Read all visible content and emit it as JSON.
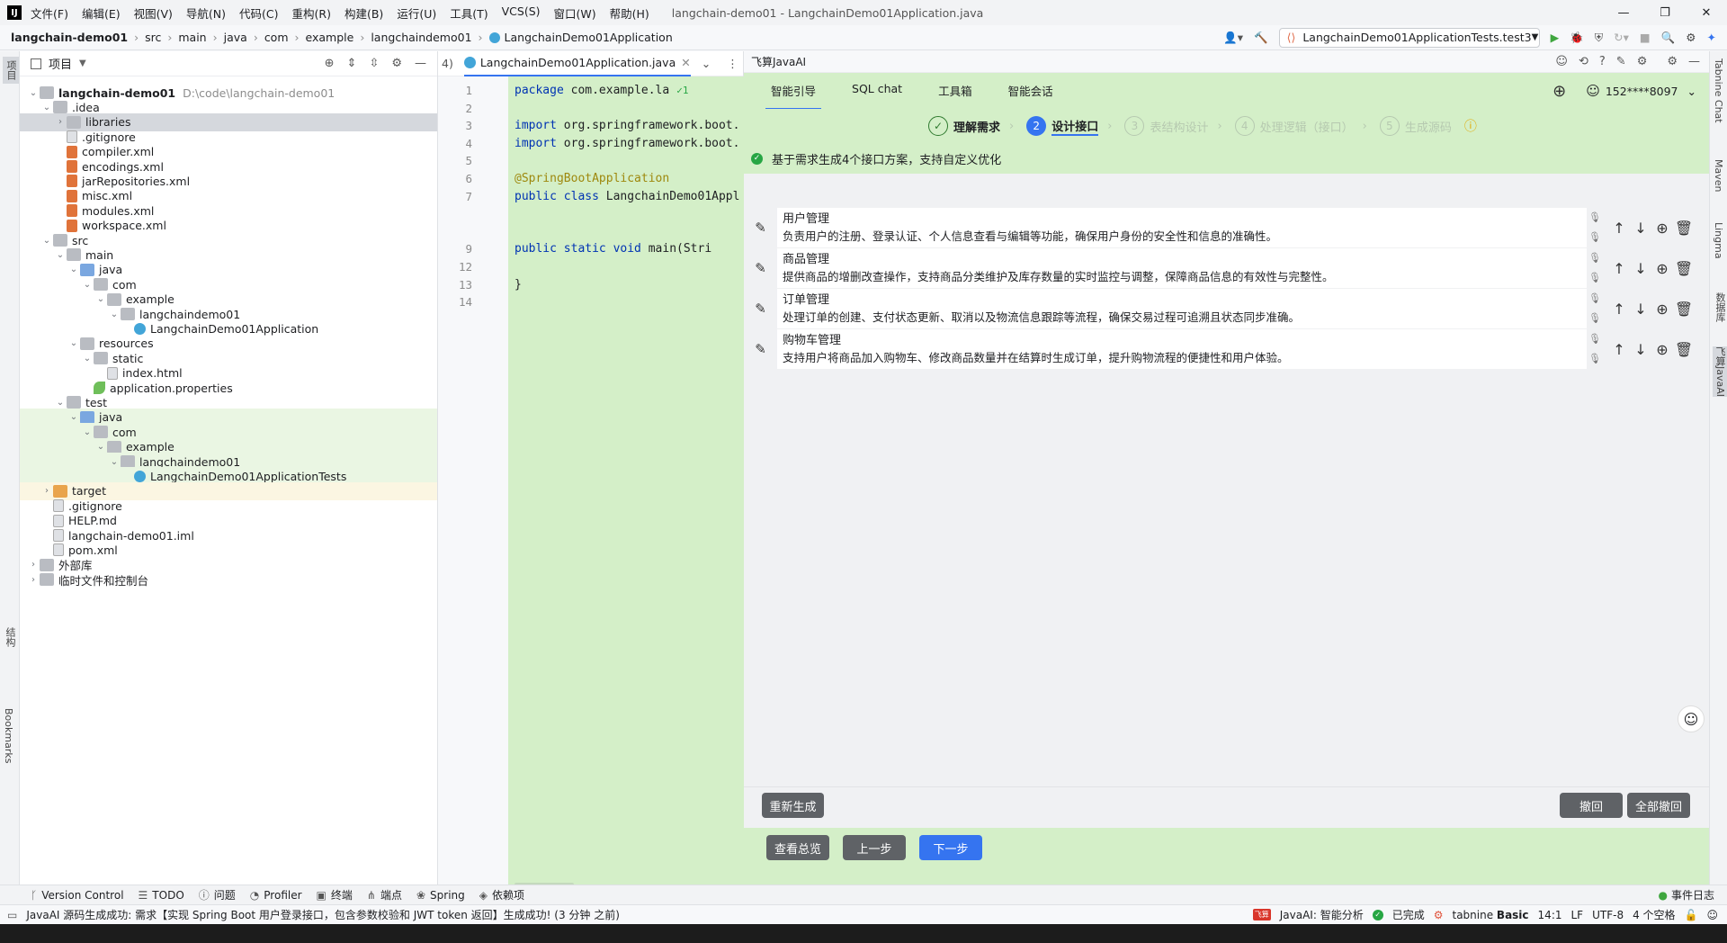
{
  "app": {
    "menus": [
      "文件(F)",
      "编辑(E)",
      "视图(V)",
      "导航(N)",
      "代码(C)",
      "重构(R)",
      "构建(B)",
      "运行(U)",
      "工具(T)",
      "VCS(S)",
      "窗口(W)",
      "帮助(H)"
    ],
    "window_title": "langchain-demo01 - LangchainDemo01Application.java"
  },
  "breadcrumbs": [
    "langchain-demo01",
    "src",
    "main",
    "java",
    "com",
    "example",
    "langchaindemo01",
    "LangchainDemo01Application"
  ],
  "run_config": "LangchainDemo01ApplicationTests.test3",
  "left_strip": {
    "project": "项目",
    "structure": "结构",
    "bookmarks": "Bookmarks"
  },
  "project_panel": {
    "title": "项目",
    "tree": [
      {
        "label": "langchain-demo01",
        "hint": "D:\\code\\langchain-demo01",
        "depth": 0,
        "arrow": "⌄",
        "icon": "folder",
        "bold": true
      },
      {
        "label": ".idea",
        "depth": 1,
        "arrow": "⌄",
        "icon": "folder"
      },
      {
        "label": "libraries",
        "depth": 2,
        "arrow": "›",
        "icon": "folder",
        "selected": true
      },
      {
        "label": ".gitignore",
        "depth": 2,
        "icon": "file"
      },
      {
        "label": "compiler.xml",
        "depth": 2,
        "icon": "xml"
      },
      {
        "label": "encodings.xml",
        "depth": 2,
        "icon": "xml"
      },
      {
        "label": "jarRepositories.xml",
        "depth": 2,
        "icon": "xml"
      },
      {
        "label": "misc.xml",
        "depth": 2,
        "icon": "xml"
      },
      {
        "label": "modules.xml",
        "depth": 2,
        "icon": "xml"
      },
      {
        "label": "workspace.xml",
        "depth": 2,
        "icon": "xml"
      },
      {
        "label": "src",
        "depth": 1,
        "arrow": "⌄",
        "icon": "folder"
      },
      {
        "label": "main",
        "depth": 2,
        "arrow": "⌄",
        "icon": "folder"
      },
      {
        "label": "java",
        "depth": 3,
        "arrow": "⌄",
        "icon": "folder-blue"
      },
      {
        "label": "com",
        "depth": 4,
        "arrow": "⌄",
        "icon": "folder"
      },
      {
        "label": "example",
        "depth": 5,
        "arrow": "⌄",
        "icon": "folder"
      },
      {
        "label": "langchaindemo01",
        "depth": 6,
        "arrow": "⌄",
        "icon": "folder"
      },
      {
        "label": "LangchainDemo01Application",
        "depth": 7,
        "icon": "jclass"
      },
      {
        "label": "resources",
        "depth": 3,
        "arrow": "⌄",
        "icon": "folder"
      },
      {
        "label": "static",
        "depth": 4,
        "arrow": "⌄",
        "icon": "folder"
      },
      {
        "label": "index.html",
        "depth": 5,
        "icon": "file"
      },
      {
        "label": "application.properties",
        "depth": 4,
        "icon": "leaf"
      },
      {
        "label": "test",
        "depth": 2,
        "arrow": "⌄",
        "icon": "folder"
      },
      {
        "label": "java",
        "depth": 3,
        "arrow": "⌄",
        "icon": "folder-green",
        "green": true
      },
      {
        "label": "com",
        "depth": 4,
        "arrow": "⌄",
        "icon": "folder",
        "green": true
      },
      {
        "label": "example",
        "depth": 5,
        "arrow": "⌄",
        "icon": "folder",
        "green": true
      },
      {
        "label": "langchaindemo01",
        "depth": 6,
        "arrow": "⌄",
        "icon": "folder",
        "green": true
      },
      {
        "label": "LangchainDemo01ApplicationTests",
        "depth": 7,
        "icon": "jclass",
        "green": true
      },
      {
        "label": "target",
        "depth": 1,
        "arrow": "›",
        "icon": "folder-orange",
        "yellow": true
      },
      {
        "label": ".gitignore",
        "depth": 1,
        "icon": "file"
      },
      {
        "label": "HELP.md",
        "depth": 1,
        "icon": "file"
      },
      {
        "label": "langchain-demo01.iml",
        "depth": 1,
        "icon": "file"
      },
      {
        "label": "pom.xml",
        "depth": 1,
        "icon": "file"
      },
      {
        "label": "外部库",
        "depth": 0,
        "arrow": "›",
        "icon": "folder"
      },
      {
        "label": "临时文件和控制台",
        "depth": 0,
        "arrow": "›",
        "icon": "folder"
      }
    ]
  },
  "editor": {
    "tab_prefix": "4)",
    "tab": "LangchainDemo01Application.java",
    "lines": [
      {
        "n": "1",
        "parts": [
          {
            "t": "package ",
            "c": "kw"
          },
          {
            "t": "com.example.la",
            "c": ""
          }
        ],
        "extra": "✓1"
      },
      {
        "n": "2",
        "parts": []
      },
      {
        "n": "3",
        "parts": [
          {
            "t": "import ",
            "c": "kw"
          },
          {
            "t": "org.springframework.boot.",
            "c": ""
          }
        ]
      },
      {
        "n": "4",
        "parts": [
          {
            "t": "import ",
            "c": "kw"
          },
          {
            "t": "org.springframework.boot.",
            "c": ""
          }
        ]
      },
      {
        "n": "5",
        "parts": []
      },
      {
        "n": "6",
        "parts": [
          {
            "t": "@SpringBootApplication",
            "c": "ann"
          }
        ]
      },
      {
        "n": "7",
        "parts": [
          {
            "t": "public class ",
            "c": "kw"
          },
          {
            "t": "LangchainDemo01Appl",
            "c": ""
          }
        ]
      },
      {
        "n": "",
        "parts": []
      },
      {
        "n": "",
        "parts": []
      },
      {
        "n": "9",
        "parts": [
          {
            "t": "    public static void ",
            "c": "kw"
          },
          {
            "t": "main",
            "c": "fn"
          },
          {
            "t": "(Stri",
            "c": ""
          }
        ]
      },
      {
        "n": "12",
        "parts": []
      },
      {
        "n": "13",
        "parts": [
          {
            "t": "}",
            "c": ""
          }
        ]
      },
      {
        "n": "14",
        "parts": []
      }
    ]
  },
  "ai_panel": {
    "title": "飞算JavaAI",
    "tabs": [
      "智能引导",
      "SQL chat",
      "工具箱",
      "智能会话"
    ],
    "user": "152****8097",
    "steps": [
      {
        "num": "✓",
        "label": "理解需求",
        "state": "done"
      },
      {
        "num": "2",
        "label": "设计接口",
        "state": "active"
      },
      {
        "num": "3",
        "label": "表结构设计",
        "state": "todo"
      },
      {
        "num": "4",
        "label": "处理逻辑（接口）",
        "state": "todo"
      },
      {
        "num": "5",
        "label": "生成源码",
        "state": "todo"
      }
    ],
    "notice": "基于需求生成4个接口方案，支持自定义优化",
    "interfaces": [
      {
        "title": "用户管理",
        "desc": "负责用户的注册、登录认证、个人信息查看与编辑等功能，确保用户身份的安全性和信息的准确性。"
      },
      {
        "title": "商品管理",
        "desc": "提供商品的增删改查操作，支持商品分类维护及库存数量的实时监控与调整，保障商品信息的有效性与完整性。"
      },
      {
        "title": "订单管理",
        "desc": "处理订单的创建、支付状态更新、取消以及物流信息跟踪等流程，确保交易过程可追溯且状态同步准确。"
      },
      {
        "title": "购物车管理",
        "desc": "支持用户将商品加入购物车、修改商品数量并在结算时生成订单，提升购物流程的便捷性和用户体验。"
      }
    ],
    "buttons": {
      "regenerate": "重新生成",
      "undo": "撤回",
      "undo_all": "全部撤回",
      "overview": "查看总览",
      "prev": "上一步",
      "next": "下一步"
    }
  },
  "right_strip": [
    "Tabnine Chat",
    "Maven",
    "Lingma",
    "数据库",
    "飞算JavaAI"
  ],
  "tool_windows": [
    "Version Control",
    "TODO",
    "问题",
    "Profiler",
    "终端",
    "端点",
    "Spring",
    "依赖项"
  ],
  "event_log": "事件日志",
  "status": {
    "message": "JavaAI 源码生成成功: 需求【实现 Spring Boot 用户登录接口，包含参数校验和 JWT token 返回】生成成功! (3 分钟 之前)",
    "javaai": "JavaAI: 智能分析",
    "done": "已完成",
    "tabnine": "tabnine",
    "tabnine_plan": "Basic",
    "position": "14:1",
    "line_sep": "LF",
    "encoding": "UTF-8",
    "indent": "4 个空格"
  },
  "colors": {
    "accent": "#3574f0",
    "ai_green": "#d4efc8",
    "selection": "#d5d8dd"
  }
}
